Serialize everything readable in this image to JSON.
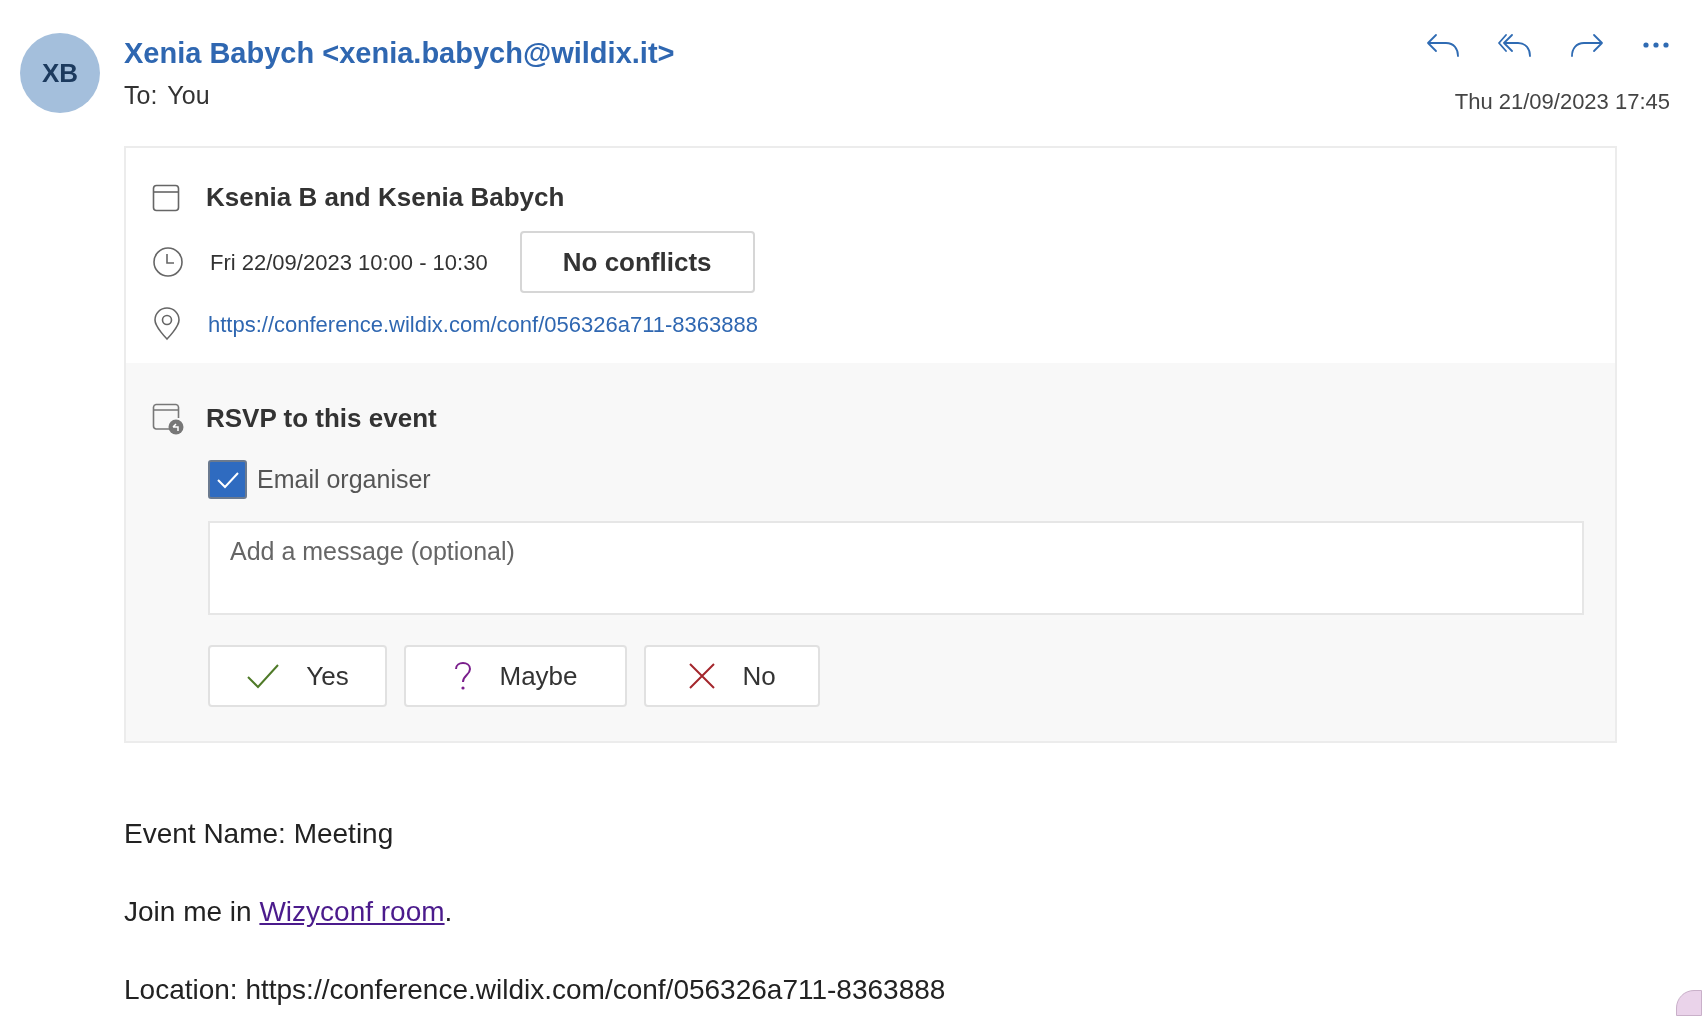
{
  "header": {
    "avatar_initials": "XB",
    "sender": "Xenia Babych <xenia.babych@wildix.it>",
    "to_label": "To:",
    "to_value": "You",
    "date": "Thu 21/09/2023 17:45"
  },
  "event": {
    "title": "Ksenia B and Ksenia Babych",
    "time": "Fri 22/09/2023 10:00 - 10:30",
    "conflicts": "No conflicts",
    "location_link": "https://conference.wildix.com/conf/056326a711-8363888"
  },
  "rsvp": {
    "heading": "RSVP to this event",
    "email_organiser": {
      "label": "Email organiser",
      "checked": true
    },
    "message": {
      "placeholder": "Add a message (optional)"
    },
    "buttons": [
      {
        "kind": "yes",
        "label": "Yes"
      },
      {
        "kind": "maybe",
        "label": "Maybe"
      },
      {
        "kind": "no",
        "label": "No"
      }
    ]
  },
  "body": {
    "event_name": "Event Name: Meeting",
    "join_prefix": "Join me in ",
    "join_link": "Wizyconf room",
    "join_suffix": ".",
    "location": "Location: https://conference.wildix.com/conf/056326a711-8363888"
  }
}
